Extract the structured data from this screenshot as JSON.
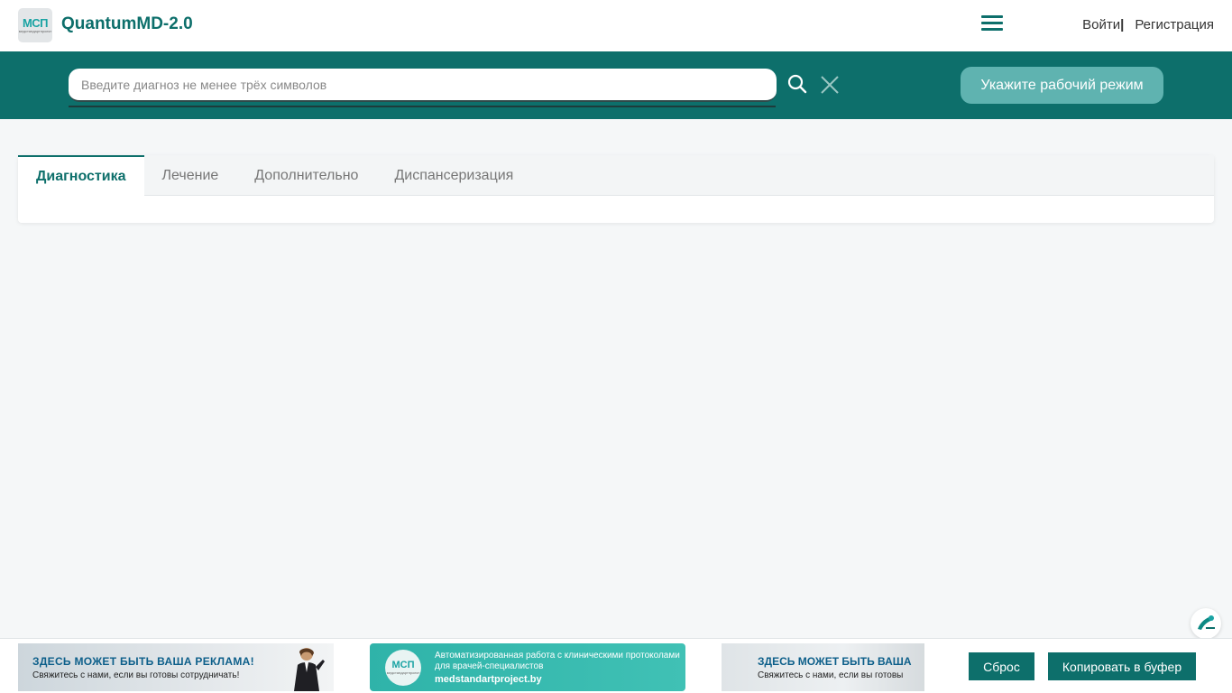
{
  "header": {
    "logo_text": "МСП",
    "logo_subtext": "медстандартпроект",
    "app_title": "QuantumMD-2.0",
    "login_label": "Войти",
    "separator": "|",
    "register_label": "Регистрация"
  },
  "search": {
    "placeholder": "Введите диагноз не менее трёх символов",
    "value": "",
    "mode_button_label": "Укажите рабочий режим"
  },
  "tabs": [
    {
      "label": "Диагностика",
      "active": true
    },
    {
      "label": "Лечение",
      "active": false
    },
    {
      "label": "Дополнительно",
      "active": false
    },
    {
      "label": "Диспансеризация",
      "active": false
    }
  ],
  "banners": {
    "ad1": {
      "title": "ЗДЕСЬ МОЖЕТ БЫТЬ ВАША РЕКЛАМА!",
      "subtitle": "Свяжитесь с нами, если вы готовы сотрудничать!"
    },
    "ad2": {
      "logo_text": "МСП",
      "logo_subtext": "медстандартпроект",
      "text": "Автоматизированная работа с клиническими протоколами для врачей-специалистов",
      "url": "medstandartproject.by"
    },
    "ad3": {
      "title": "ЗДЕСЬ МОЖЕТ БЫТЬ ВАША",
      "subtitle": "Свяжитесь с нами, если вы готовы"
    }
  },
  "footer": {
    "reset_label": "Сброс",
    "copy_label": "Копировать в буфер"
  },
  "colors": {
    "primary": "#0d6f6b",
    "mode_button": "#5fb3b0",
    "background": "#f5f7f8"
  }
}
